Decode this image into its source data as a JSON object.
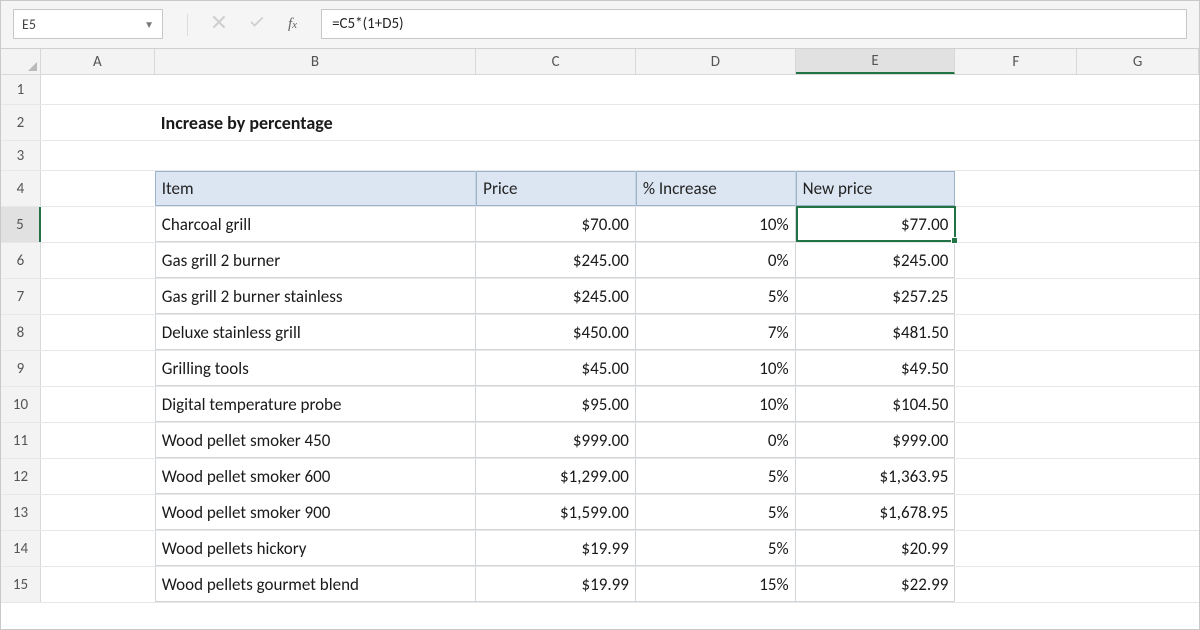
{
  "formula_bar": {
    "name_box": "E5",
    "formula": "=C5*(1+D5)"
  },
  "columns": [
    "A",
    "B",
    "C",
    "D",
    "E",
    "F",
    "G"
  ],
  "title": "Increase by percentage",
  "headers": {
    "item": "Item",
    "price": "Price",
    "increase": "% Increase",
    "new_price": "New price"
  },
  "rows": [
    {
      "n": 5,
      "item": "Charcoal grill",
      "price": "$70.00",
      "increase": "10%",
      "new_price": "$77.00"
    },
    {
      "n": 6,
      "item": "Gas grill 2 burner",
      "price": "$245.00",
      "increase": "0%",
      "new_price": "$245.00"
    },
    {
      "n": 7,
      "item": "Gas grill 2 burner stainless",
      "price": "$245.00",
      "increase": "5%",
      "new_price": "$257.25"
    },
    {
      "n": 8,
      "item": "Deluxe stainless grill",
      "price": "$450.00",
      "increase": "7%",
      "new_price": "$481.50"
    },
    {
      "n": 9,
      "item": "Grilling tools",
      "price": "$45.00",
      "increase": "10%",
      "new_price": "$49.50"
    },
    {
      "n": 10,
      "item": "Digital temperature probe",
      "price": "$95.00",
      "increase": "10%",
      "new_price": "$104.50"
    },
    {
      "n": 11,
      "item": "Wood pellet smoker 450",
      "price": "$999.00",
      "increase": "0%",
      "new_price": "$999.00"
    },
    {
      "n": 12,
      "item": "Wood pellet smoker 600",
      "price": "$1,299.00",
      "increase": "5%",
      "new_price": "$1,363.95"
    },
    {
      "n": 13,
      "item": "Wood pellet smoker 900",
      "price": "$1,599.00",
      "increase": "5%",
      "new_price": "$1,678.95"
    },
    {
      "n": 14,
      "item": "Wood pellets hickory",
      "price": "$19.99",
      "increase": "5%",
      "new_price": "$20.99"
    },
    {
      "n": 15,
      "item": "Wood pellets gourmet blend",
      "price": "$19.99",
      "increase": "15%",
      "new_price": "$22.99"
    }
  ],
  "selected": {
    "cell": "E5",
    "row": 5,
    "col": "E"
  }
}
